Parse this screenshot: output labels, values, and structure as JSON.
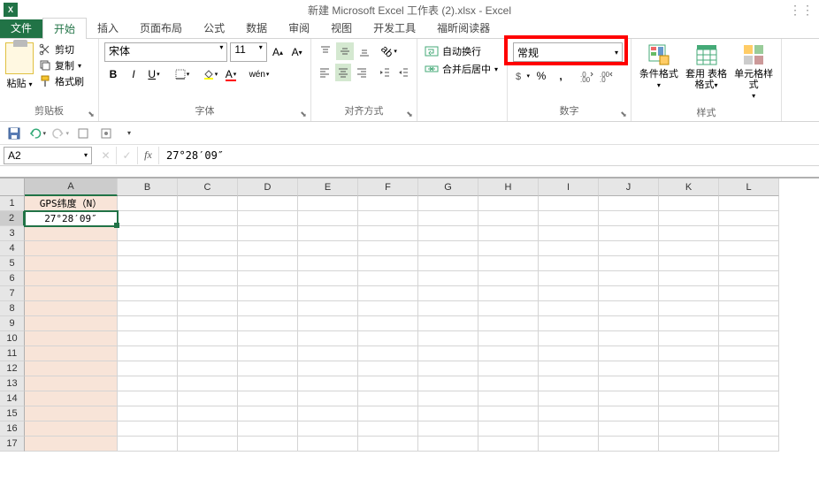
{
  "title": "新建 Microsoft Excel 工作表 (2).xlsx - Excel",
  "app_abbr": "X",
  "tabs": {
    "file": "文件",
    "home": "开始",
    "insert": "插入",
    "layout": "页面布局",
    "formulas": "公式",
    "data": "数据",
    "review": "审阅",
    "view": "视图",
    "developer": "开发工具",
    "foxit": "福昕阅读器"
  },
  "clipboard": {
    "paste": "粘贴",
    "cut": "剪切",
    "copy": "复制",
    "format_painter": "格式刷",
    "label": "剪贴板"
  },
  "font": {
    "name": "宋体",
    "size": "11",
    "label": "字体"
  },
  "alignment": {
    "wrap": "自动换行",
    "merge": "合并后居中",
    "label": "对齐方式"
  },
  "number": {
    "format": "常规",
    "label": "数字"
  },
  "styles": {
    "conditional": "条件格式",
    "table": "套用\n表格格式",
    "cell_styles": "单元格样式",
    "label": "样式"
  },
  "name_box": "A2",
  "formula_value": "27°28′09″",
  "columns": [
    "A",
    "B",
    "C",
    "D",
    "E",
    "F",
    "G",
    "H",
    "I",
    "J",
    "K",
    "L"
  ],
  "col_widths": {
    "A": 105,
    "default": 68
  },
  "rows": [
    1,
    2,
    3,
    4,
    5,
    6,
    7,
    8,
    9,
    10,
    11,
    12,
    13,
    14,
    15,
    16,
    17
  ],
  "cells": {
    "A1": "GPS纬度（N）",
    "A2": "27°28′09″"
  },
  "selected_cell": "A2"
}
